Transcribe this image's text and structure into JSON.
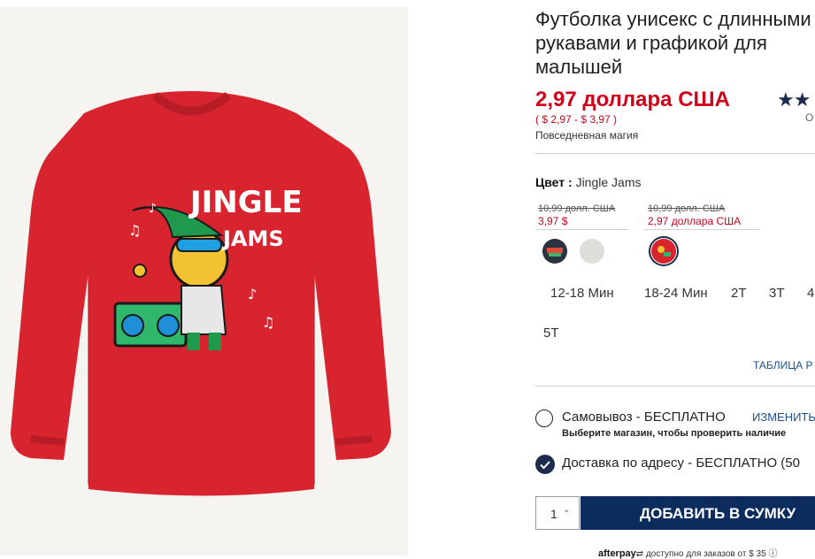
{
  "product": {
    "title": "Футболка унисекс с длинными рукавами и графикой для малышей",
    "price": "2,97 доллара США",
    "price_range": "( $ 2,97 - $ 3,97 )",
    "promo": "Повседневная магия",
    "rating_stars": "★★",
    "rating_sub": "О",
    "graphic_text_1": "JINGLE",
    "graphic_text_2": "JAMS"
  },
  "color": {
    "label": "Цвет :",
    "value": "Jingle Jams",
    "groups": [
      {
        "old_price": "10,99 долл. США",
        "sale_price": "3,97 $"
      },
      {
        "old_price": "10,99 долл. США",
        "sale_price": "2,97 доллара США"
      }
    ]
  },
  "sizes": [
    "12-18 Мин",
    "18-24 Мин",
    "2T",
    "3T",
    "4",
    "5T"
  ],
  "size_chart_link": "ТАБЛИЦА Р",
  "fulfillment": {
    "pickup_label": "Самовывоз - БЕСПЛАТНО",
    "pickup_change": "ИЗМЕНИТЬ",
    "pickup_note": "Выберите магазин, чтобы проверить наличие",
    "delivery_label": "Доставка по адресу - БЕСПЛАТНО (50"
  },
  "cart": {
    "quantity": "1",
    "add_label": "ДОБАВИТЬ В СУМКУ"
  },
  "afterpay": {
    "brand": "afterpay",
    "text": "доступно для заказов от $ 35 ⓘ"
  },
  "colors": {
    "sale_red": "#d0021b",
    "navy": "#0c2c5e",
    "shirt_red": "#d8242f"
  }
}
